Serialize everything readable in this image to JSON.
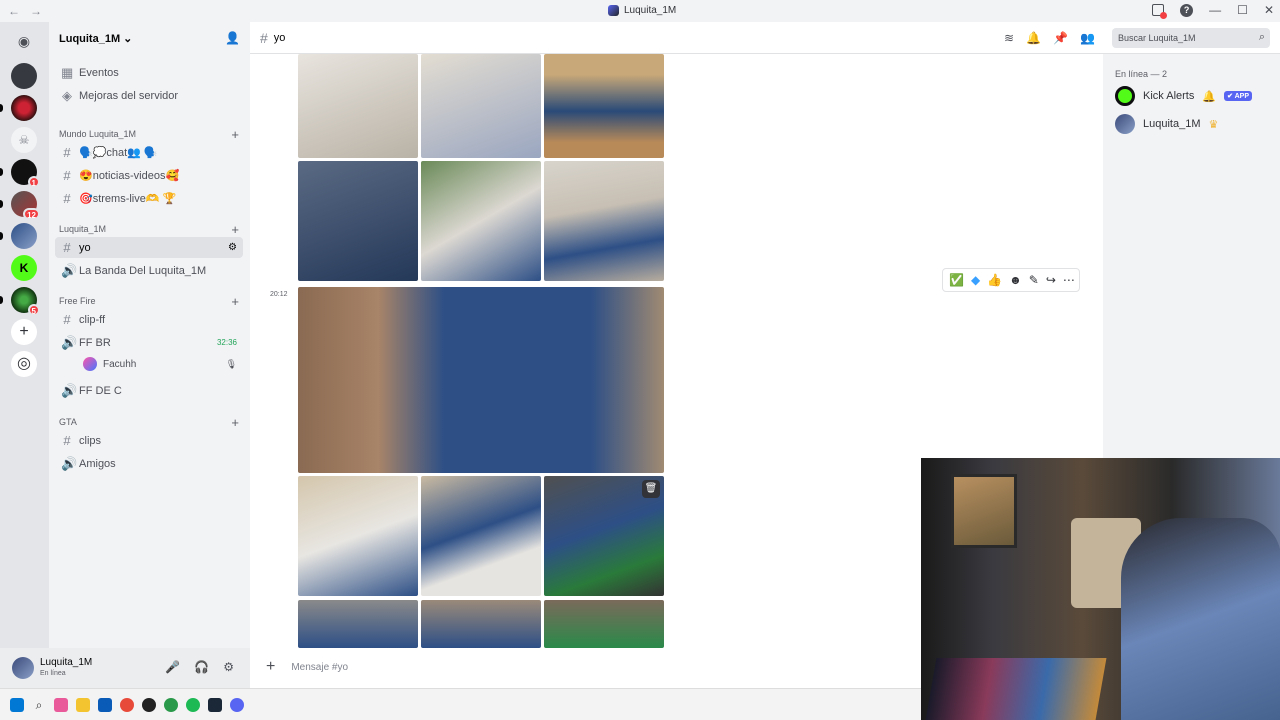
{
  "window": {
    "title": "Luquita_1M"
  },
  "server": {
    "name": "Luquita_1M"
  },
  "sidebar": {
    "top_items": [
      {
        "label": "Eventos"
      },
      {
        "label": "Mejoras del servidor"
      }
    ],
    "categories": [
      {
        "label": "Mundo Luquita_1M"
      },
      {
        "label": "Luquita_1M"
      },
      {
        "label": "Free Fire"
      },
      {
        "label": "GTA"
      }
    ],
    "channels": {
      "chat": "🗣️💭chat👥 🗣️",
      "noticias": "😍noticias-videos🥰",
      "strems": "🎯strems-live🫶 🏆",
      "yo": "yo",
      "banda": "La Banda Del Luquita_1M",
      "clipff": "clip-ff",
      "ffbr": "FF BR",
      "ffbr_time": "32:36",
      "ffbr_user": "Facuhh",
      "ffdec": "FF DE C",
      "clips": "clips",
      "amigos": "Amigos"
    }
  },
  "guild_badges": [
    "1",
    "12",
    "5"
  ],
  "user": {
    "name": "Luquita_1M",
    "status": "En línea"
  },
  "header": {
    "channel": "yo",
    "search_placeholder": "Buscar Luquita_1M"
  },
  "message": {
    "timestamp": "20:12"
  },
  "composer": {
    "placeholder": "Mensaje #yo"
  },
  "members": {
    "heading": "En línea — 2",
    "list": [
      {
        "name": "Kick Alerts",
        "badge": "✔ APP"
      },
      {
        "name": "Luquita_1M"
      }
    ]
  },
  "colors": {
    "accent": "#5865f2",
    "online": "#23a559",
    "badge": "#f23f43",
    "jersey": "#2d4f86"
  }
}
